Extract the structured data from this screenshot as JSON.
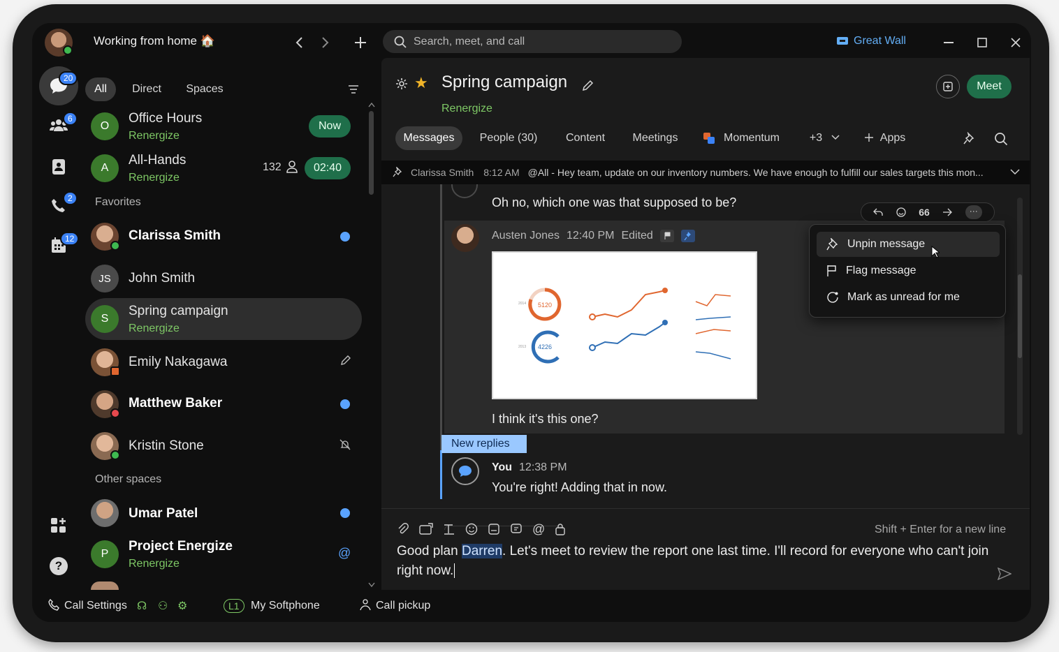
{
  "window": {
    "status_title": "Working from home 🏠",
    "search_placeholder": "Search, meet, and call",
    "org_label": "Great Wall"
  },
  "rail": {
    "chat_badge": "20",
    "teams_badge": "6",
    "calls_badge": "2",
    "calendar_badge": "12"
  },
  "filters": {
    "all": "All",
    "direct": "Direct",
    "spaces": "Spaces"
  },
  "list": {
    "office_hours": {
      "initial": "O",
      "name": "Office Hours",
      "sub": "Renergize",
      "pill": "Now"
    },
    "all_hands": {
      "initial": "A",
      "name": "All-Hands",
      "sub": "Renergize",
      "count": "132",
      "pill": "02:40"
    },
    "favorites_label": "Favorites",
    "clarissa": {
      "name": "Clarissa Smith"
    },
    "john": {
      "initial": "JS",
      "name": "John Smith"
    },
    "spring": {
      "initial": "S",
      "name": "Spring campaign",
      "sub": "Renergize"
    },
    "emily": {
      "name": "Emily Nakagawa"
    },
    "matthew": {
      "name": "Matthew Baker"
    },
    "kristin": {
      "name": "Kristin Stone"
    },
    "other_label": "Other spaces",
    "umar": {
      "name": "Umar Patel"
    },
    "project": {
      "initial": "P",
      "name": "Project Energize",
      "sub": "Renergize"
    }
  },
  "bottom_bar": {
    "call_settings": "Call Settings",
    "line": "L1",
    "softphone": "My Softphone",
    "pickup": "Call pickup"
  },
  "space": {
    "title": "Spring campaign",
    "subtitle": "Renergize",
    "meet_label": "Meet",
    "tabs": [
      "Messages",
      "People (30)",
      "Content",
      "Meetings",
      "Momentum",
      "+3",
      "Apps"
    ]
  },
  "pinned_bar": {
    "author": "Clarissa Smith",
    "time": "8:12 AM",
    "text": "@All - Hey team, update on our inventory numbers. We have enough to fulfill our sales targets this mon..."
  },
  "messages": {
    "prev_text": "Oh no, which one was that supposed to be?",
    "austen_name": "Austen Jones",
    "austen_time": "12:40 PM",
    "austen_edited": "Edited",
    "chart_label_top": "5120",
    "chart_label_bottom": "4226",
    "austen_text": "I think it's this one?",
    "new_replies": "New replies",
    "you_name": "You",
    "you_time": "12:38 PM",
    "you_text": "You're right! Adding that in now."
  },
  "context_menu": {
    "unpin": "Unpin message",
    "flag": "Flag message",
    "unread": "Mark as unread for me"
  },
  "composer": {
    "hint": "Shift + Enter for a new line",
    "text_before": "Good plan ",
    "mention": "Darren",
    "text_after": ". Let's meet to review the report one last time. I'll record for everyone who can't join right now."
  },
  "colors": {
    "accent_green": "#7ec865",
    "meet_green": "#1f6f4a",
    "unread_blue": "#5aa3ff",
    "orange": "#e0662f",
    "blue_chart": "#2f6fb5"
  }
}
